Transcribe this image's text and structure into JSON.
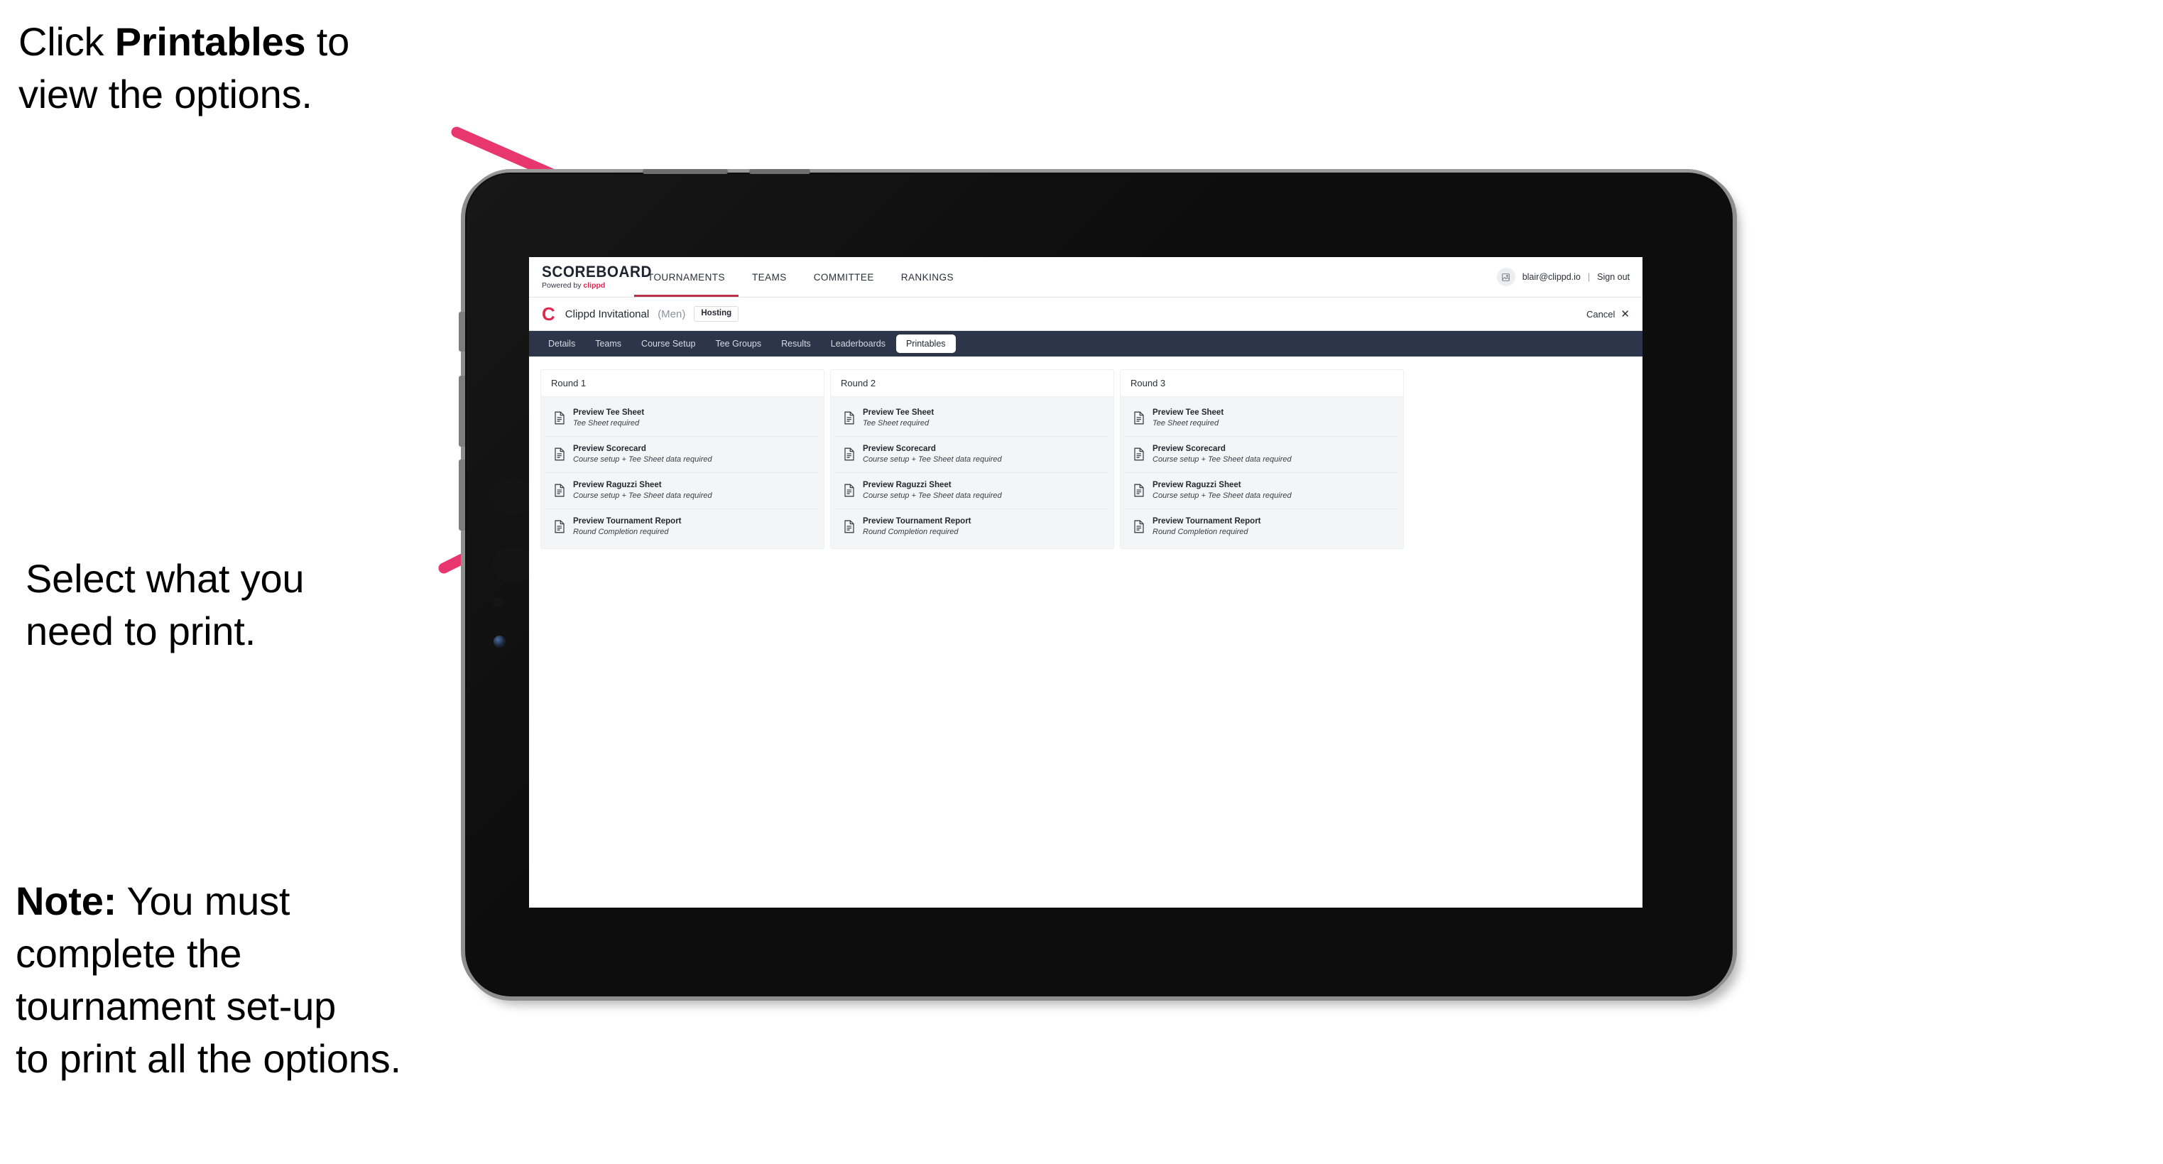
{
  "annotations": {
    "click_printables": {
      "before": "Click ",
      "bold": "Printables",
      "after": " to\nview the options."
    },
    "select_print": {
      "text": "Select what you\n need to print."
    },
    "note": {
      "bold": "Note:",
      "text": " You must\ncomplete the\ntournament set-up\nto print all the options."
    }
  },
  "colors": {
    "accent_pink": "#e8376f",
    "brand_red": "#e0284f",
    "nav_dark": "#2c3549",
    "tournaments_underline": "#b9304a"
  },
  "app": {
    "brand": {
      "title": "SCOREBOARD",
      "powered_prefix": "Powered by ",
      "powered_name": "clippd"
    },
    "top_nav": [
      {
        "label": "TOURNAMENTS",
        "active": true
      },
      {
        "label": "TEAMS",
        "active": false
      },
      {
        "label": "COMMITTEE",
        "active": false
      },
      {
        "label": "RANKINGS",
        "active": false
      }
    ],
    "account": {
      "avatar_icon": "user-avatar-icon",
      "email": "blair@clippd.io",
      "separator": "|",
      "sign_out": "Sign out"
    },
    "tournament_bar": {
      "logo_letter": "C",
      "name": "Clippd Invitational",
      "gender": "(Men)",
      "badge": "Hosting",
      "cancel_label": "Cancel",
      "cancel_icon": "close-x-icon"
    },
    "tabs": [
      {
        "label": "Details",
        "active": false
      },
      {
        "label": "Teams",
        "active": false
      },
      {
        "label": "Course Setup",
        "active": false
      },
      {
        "label": "Tee Groups",
        "active": false
      },
      {
        "label": "Results",
        "active": false
      },
      {
        "label": "Leaderboards",
        "active": false
      },
      {
        "label": "Printables",
        "active": true
      }
    ],
    "rounds": [
      {
        "title": "Round 1",
        "items": [
          {
            "title": "Preview Tee Sheet",
            "sub": "Tee Sheet required"
          },
          {
            "title": "Preview Scorecard",
            "sub": "Course setup + Tee Sheet data required"
          },
          {
            "title": "Preview Raguzzi Sheet",
            "sub": "Course setup + Tee Sheet data required"
          },
          {
            "title": "Preview Tournament Report",
            "sub": "Round Completion required"
          }
        ]
      },
      {
        "title": "Round 2",
        "items": [
          {
            "title": "Preview Tee Sheet",
            "sub": "Tee Sheet required"
          },
          {
            "title": "Preview Scorecard",
            "sub": "Course setup + Tee Sheet data required"
          },
          {
            "title": "Preview Raguzzi Sheet",
            "sub": "Course setup + Tee Sheet data required"
          },
          {
            "title": "Preview Tournament Report",
            "sub": "Round Completion required"
          }
        ]
      },
      {
        "title": "Round 3",
        "items": [
          {
            "title": "Preview Tee Sheet",
            "sub": "Tee Sheet required"
          },
          {
            "title": "Preview Scorecard",
            "sub": "Course setup + Tee Sheet data required"
          },
          {
            "title": "Preview Raguzzi Sheet",
            "sub": "Course setup + Tee Sheet data required"
          },
          {
            "title": "Preview Tournament Report",
            "sub": "Round Completion required"
          }
        ]
      }
    ]
  }
}
